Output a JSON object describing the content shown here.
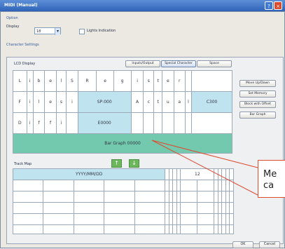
{
  "window": {
    "title": "MIDI (Manual)"
  },
  "setup": {
    "section": "Option",
    "display_label": "Display",
    "display_value": "18",
    "checkbox_label": "Lights Indication"
  },
  "character_settings": {
    "section": "Character Settings",
    "group": "LCD Display",
    "top_buttons": [
      "Inputs/Output",
      "Special Character",
      "Space"
    ],
    "rows": [
      [
        "L",
        "i",
        "b",
        "e",
        "l",
        "S",
        "R",
        "e",
        "g",
        "i",
        "s",
        "t",
        "e",
        "r",
        "",
        ""
      ],
      [
        "F",
        "i",
        "l",
        "e",
        "s",
        "i",
        "SP:000",
        "",
        "",
        "A",
        "c",
        "t",
        "u",
        "a",
        "l",
        "C300"
      ],
      [
        "D",
        "i",
        "f",
        "f",
        "i",
        "",
        "E0000",
        "",
        "",
        "",
        "",
        "",
        "",
        "",
        "",
        ""
      ]
    ],
    "bar_text": "Bar Graph  00000"
  },
  "side_buttons": [
    "Move Up/Down",
    "Set Memory",
    "Block with Offset",
    "Bar Graph"
  ],
  "track": {
    "label": "Track Map",
    "arrow_left": "↑",
    "arrow_right": "↓",
    "header_left": "YYYY/MM/DD",
    "header_right": "12"
  },
  "callout": {
    "text": "Me\nca"
  },
  "footer": {
    "ok": "OK",
    "cancel": "Cancel"
  }
}
